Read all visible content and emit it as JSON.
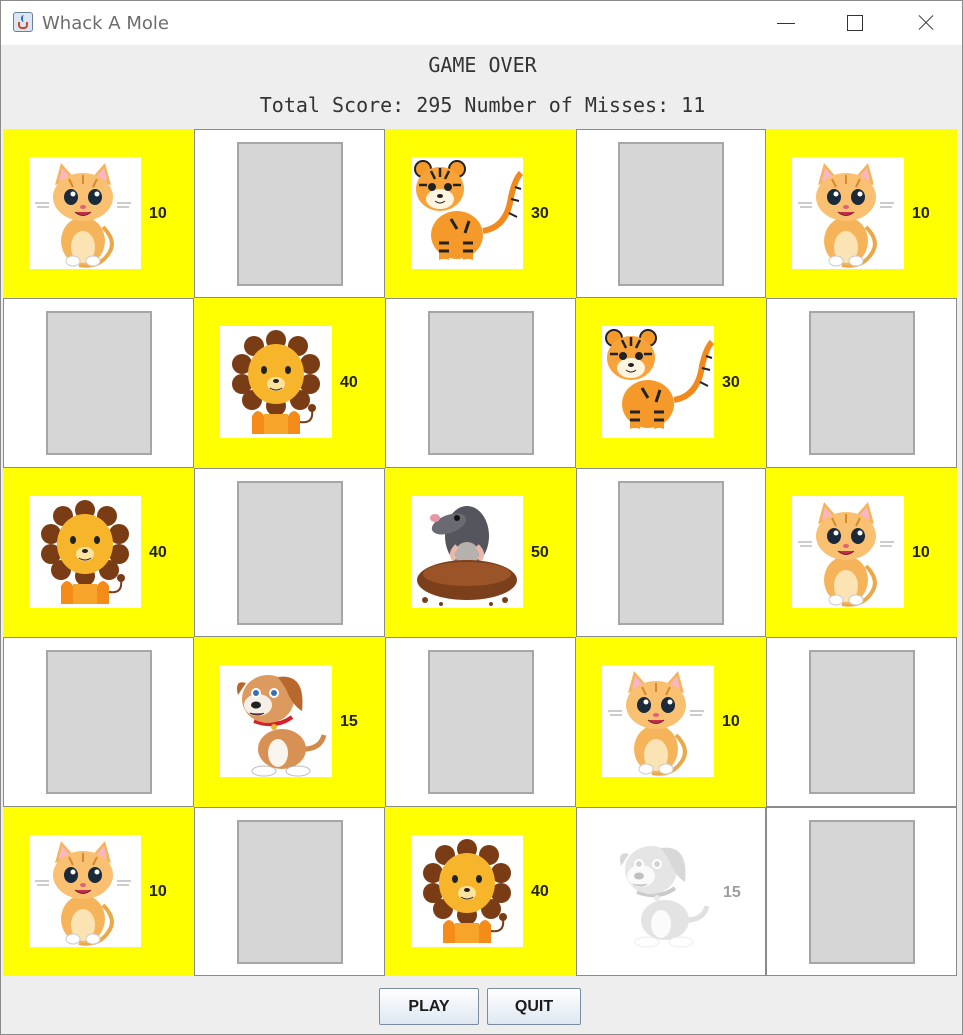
{
  "window": {
    "title": "Whack A Mole"
  },
  "status": {
    "game_state": "GAME OVER",
    "score_line": "Total Score: 295  Number of Misses: 11"
  },
  "grid": {
    "rows": [
      [
        {
          "animal": "cat",
          "points": "10"
        },
        {
          "animal": "empty"
        },
        {
          "animal": "tiger",
          "points": "30"
        },
        {
          "animal": "empty"
        },
        {
          "animal": "cat",
          "points": "10"
        }
      ],
      [
        {
          "animal": "empty"
        },
        {
          "animal": "lion",
          "points": "40"
        },
        {
          "animal": "empty"
        },
        {
          "animal": "tiger",
          "points": "30"
        },
        {
          "animal": "empty"
        }
      ],
      [
        {
          "animal": "lion",
          "points": "40"
        },
        {
          "animal": "empty"
        },
        {
          "animal": "mole",
          "points": "50"
        },
        {
          "animal": "empty"
        },
        {
          "animal": "cat",
          "points": "10"
        }
      ],
      [
        {
          "animal": "empty"
        },
        {
          "animal": "dog",
          "points": "15"
        },
        {
          "animal": "empty"
        },
        {
          "animal": "cat",
          "points": "10"
        },
        {
          "animal": "empty"
        }
      ],
      [
        {
          "animal": "cat",
          "points": "10"
        },
        {
          "animal": "empty"
        },
        {
          "animal": "lion",
          "points": "40"
        },
        {
          "animal": "dog",
          "points": "15",
          "disabled": true
        },
        {
          "animal": "empty"
        }
      ]
    ]
  },
  "buttons": {
    "play": "PLAY",
    "quit": "QUIT"
  },
  "colors": {
    "active_cell": "#ffff00",
    "empty_cell": "#ffffff",
    "placeholder": "#d6d6d6"
  }
}
